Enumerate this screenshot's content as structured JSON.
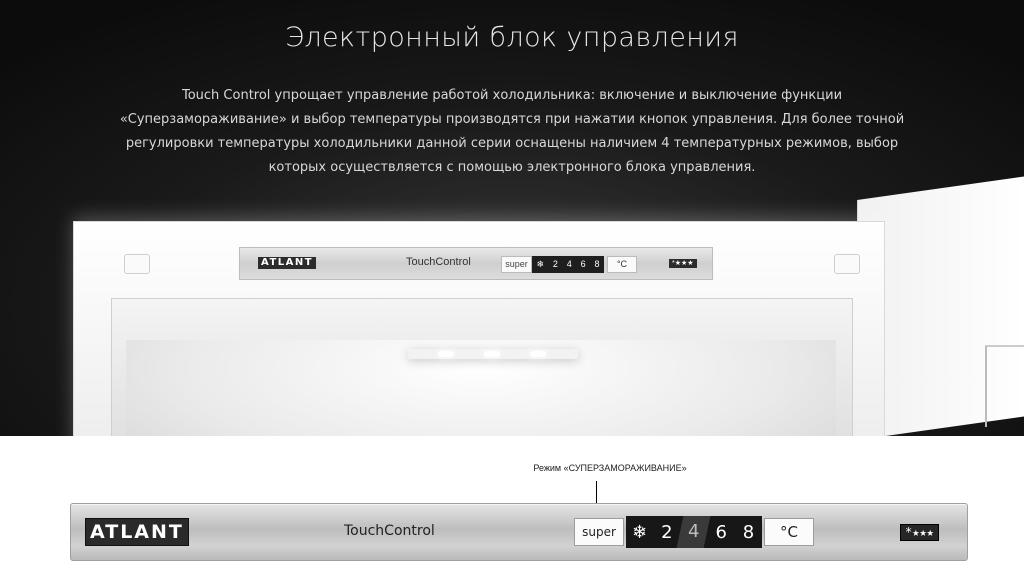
{
  "header": {
    "title": "Электронный блок управления",
    "description": "Touch Control упрощает управление работой  холодильника: включение и выключение функции «Суперзамораживание» и выбор температуры производятся при нажатии кнопок управления. Для более точной регулировки температуры холодильники данной серии оснащены наличием 4 температурных режимов, выбор которых осуществляется с помощью электронного блока управления."
  },
  "annotation": {
    "mode_label": "Режим «СУПЕРЗАМОРАЖИВАНИЕ»"
  },
  "panel": {
    "brand": "ATLANT",
    "touch_control": "TouchControl",
    "super_label": "super",
    "snowflake_icon": "snowflake-icon",
    "levels": [
      "2",
      "4",
      "6",
      "8"
    ],
    "active_level": "4",
    "unit_label": "°C",
    "freezer_stars": "*★★★"
  },
  "mini_panel": {
    "brand": "ATLANT",
    "touch_control": "TouchControl",
    "super_label": "super",
    "levels": [
      "2",
      "4",
      "6",
      "8"
    ],
    "unit_label": "°C",
    "freezer_stars": "*★★★"
  },
  "colors": {
    "hero_background": "#1a1a1a",
    "display_background": "#171717",
    "panel_metal": "#c8c8c8"
  }
}
